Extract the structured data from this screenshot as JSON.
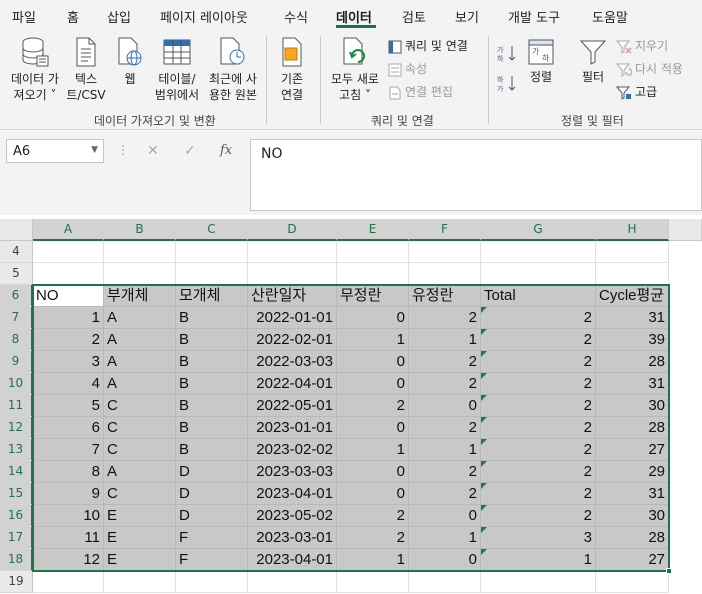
{
  "menu": {
    "tabs": [
      "파일",
      "홈",
      "삽입",
      "페이지 레이아웃",
      "수식",
      "데이터",
      "검토",
      "보기",
      "개발 도구",
      "도움말"
    ],
    "active": "데이터"
  },
  "ribbon": {
    "get_data": {
      "label1": "데이터 가",
      "label2": "져오기 ˅"
    },
    "text_csv": {
      "label1": "텍스",
      "label2": "트/CSV"
    },
    "web": {
      "label1": "웹"
    },
    "from_table": {
      "label1": "테이블/",
      "label2": "범위에서"
    },
    "recent_sources": {
      "label1": "최근에 사",
      "label2": "용한 원본"
    },
    "existing_conn": {
      "label1": "기존",
      "label2": "연결"
    },
    "group1_label": "데이터 가져오기 및 변환",
    "refresh_all": {
      "label1": "모두 새로",
      "label2": "고침 ˅"
    },
    "queries_connections": "쿼리 및 연결",
    "properties": "속성",
    "edit_links": "연결 편집",
    "group2_label": "쿼리 및 연결",
    "sort_asc_icon": "sort-az",
    "sort_desc_icon": "sort-za",
    "sort": "정렬",
    "filter": "필터",
    "clear": "지우기",
    "reapply": "다시 적용",
    "advanced": "고급",
    "group3_label": "정렬 및 필터"
  },
  "formula_bar": {
    "name_box": "A6",
    "formula": "NO"
  },
  "grid": {
    "columns": [
      "A",
      "B",
      "C",
      "D",
      "E",
      "F",
      "G",
      "H"
    ],
    "rows": [
      4,
      5,
      6,
      7,
      8,
      9,
      10,
      11,
      12,
      13,
      14,
      15,
      16,
      17,
      18,
      19
    ],
    "headers": [
      "NO",
      "부개체",
      "모개체",
      "산란일자",
      "무정란",
      "유정란",
      "Total",
      "Cycle평균"
    ],
    "data": [
      [
        "1",
        "A",
        "B",
        "2022-01-01",
        "0",
        "2",
        "2",
        "31"
      ],
      [
        "2",
        "A",
        "B",
        "2022-02-01",
        "1",
        "1",
        "2",
        "39"
      ],
      [
        "3",
        "A",
        "B",
        "2022-03-03",
        "0",
        "2",
        "2",
        "28"
      ],
      [
        "4",
        "A",
        "B",
        "2022-04-01",
        "0",
        "2",
        "2",
        "31"
      ],
      [
        "5",
        "C",
        "B",
        "2022-05-01",
        "2",
        "0",
        "2",
        "30"
      ],
      [
        "6",
        "C",
        "B",
        "2023-01-01",
        "0",
        "2",
        "2",
        "28"
      ],
      [
        "7",
        "C",
        "B",
        "2023-02-02",
        "1",
        "1",
        "2",
        "27"
      ],
      [
        "8",
        "A",
        "D",
        "2023-03-03",
        "0",
        "2",
        "2",
        "29"
      ],
      [
        "9",
        "C",
        "D",
        "2023-04-01",
        "0",
        "2",
        "2",
        "31"
      ],
      [
        "10",
        "E",
        "D",
        "2023-05-02",
        "2",
        "0",
        "2",
        "30"
      ],
      [
        "11",
        "E",
        "F",
        "2023-03-01",
        "2",
        "1",
        "3",
        "28"
      ],
      [
        "12",
        "E",
        "F",
        "2023-04-01",
        "1",
        "0",
        "1",
        "27"
      ]
    ]
  },
  "colors": {
    "accent": "#217346",
    "selection_fill": "#c8c8c8",
    "error_indicator": "#1e7b3c"
  }
}
